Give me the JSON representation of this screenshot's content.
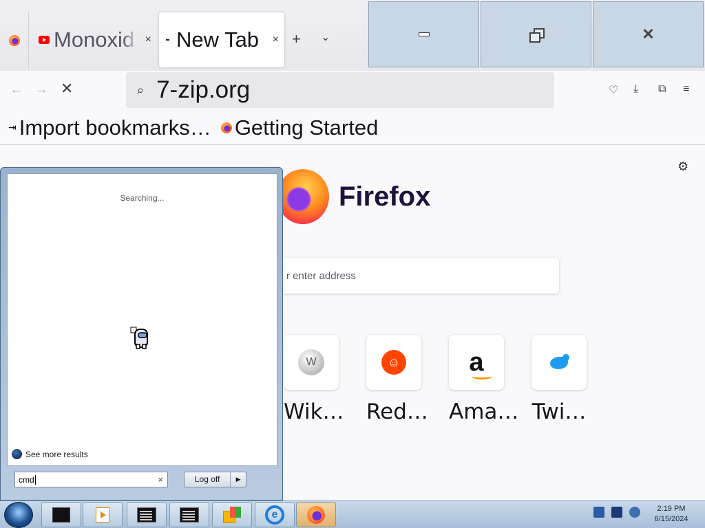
{
  "browser": {
    "tabs": [
      {
        "title": "Monoxid",
        "close": "×"
      },
      {
        "title": "New Tab",
        "close": "×"
      }
    ],
    "new_tab_symbol": "+",
    "tab_list_symbol": "⌄",
    "window_buttons": {
      "minimize": "minimize-icon",
      "restore": "restore-icon",
      "close": "✕"
    },
    "nav": {
      "back": "←",
      "forward": "→",
      "stop": "✕"
    },
    "urlbar": {
      "search_symbol": "⌕",
      "value": "7-zip.org"
    },
    "toolbar_icons": [
      "pocket-icon",
      "download-icon",
      "extensions-icon",
      "menu-icon"
    ],
    "bookmarks": [
      {
        "label": "Import bookmarks…",
        "icon": "⇥"
      },
      {
        "label": "Getting Started",
        "icon": "firefox-icon"
      }
    ]
  },
  "newtab": {
    "brand": "Firefox",
    "search_placeholder": "r enter address",
    "top_sites": [
      {
        "label": "Wik…",
        "icon": "wikipedia-icon"
      },
      {
        "label": "Red…",
        "icon": "reddit-icon"
      },
      {
        "label": "Ama…",
        "icon": "amazon-icon"
      },
      {
        "label": "Twi…",
        "icon": "twitter-icon"
      }
    ],
    "settings_symbol": "⚙"
  },
  "startmenu": {
    "status": "Searching...",
    "see_more": "See more results",
    "search_value": "cmd",
    "clear_symbol": "×",
    "logoff_label": "Log off",
    "logoff_arrow": "▶"
  },
  "taskbar": {
    "clock_time": "2:19 PM",
    "clock_date": "6/15/2024"
  },
  "colors": {
    "accent": "#1e7ed8",
    "taskbar": "#b8cce0",
    "firefox_purple": "#20123a"
  }
}
